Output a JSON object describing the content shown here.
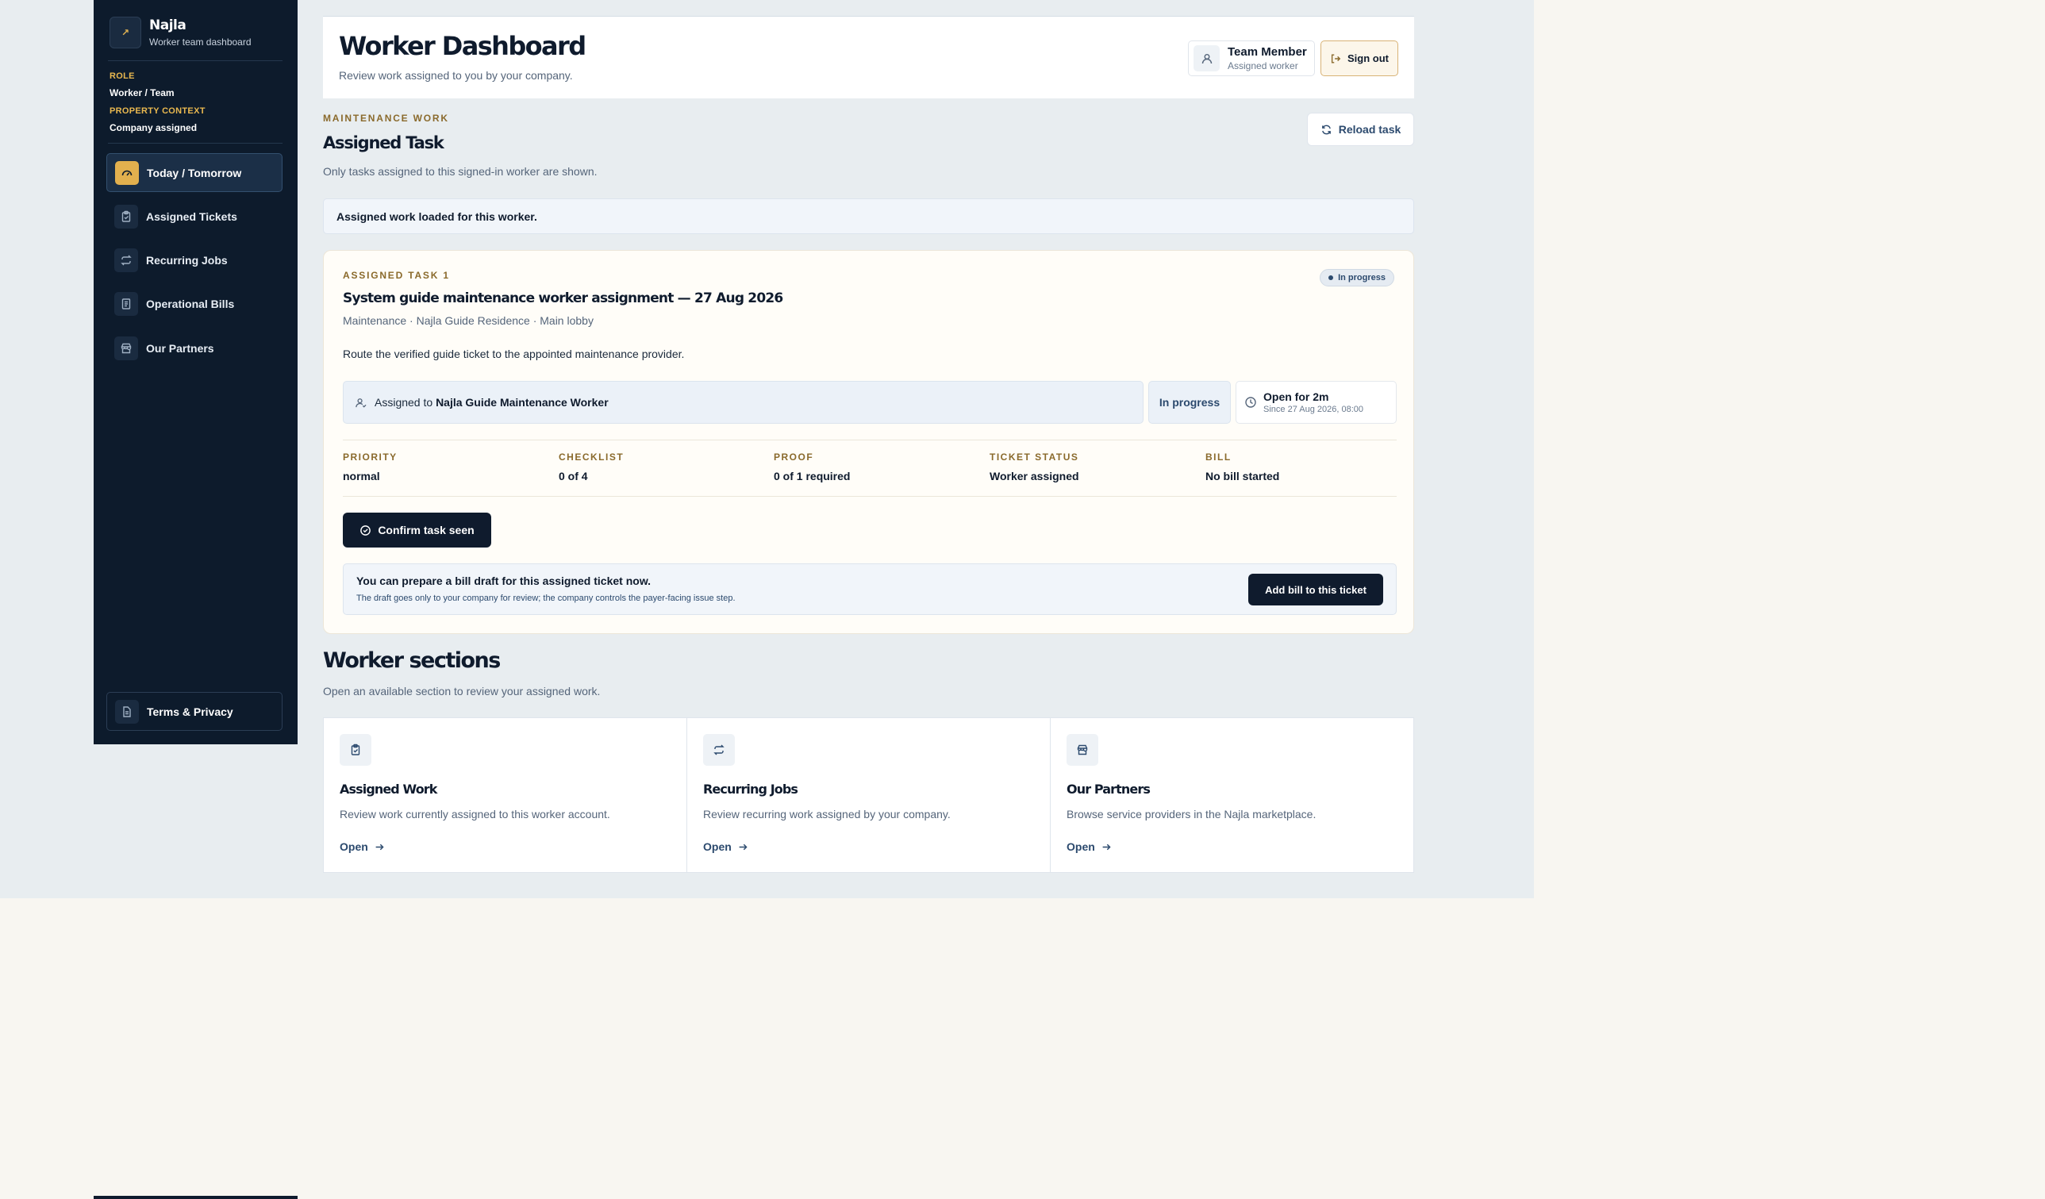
{
  "brand": {
    "logo_text": "↗",
    "name": "Najla",
    "subtitle": "Worker team dashboard"
  },
  "context": {
    "role_label": "ROLE",
    "role_value": "Worker / Team",
    "property_label": "PROPERTY CONTEXT",
    "property_value": "Company assigned"
  },
  "sidebar": {
    "items": [
      {
        "label": "Today / Tomorrow",
        "icon": "gauge-icon",
        "active": true
      },
      {
        "label": "Assigned Tickets",
        "icon": "clipboard-icon"
      },
      {
        "label": "Recurring Jobs",
        "icon": "repeat-icon"
      },
      {
        "label": "Operational Bills",
        "icon": "receipt-icon"
      },
      {
        "label": "Our Partners",
        "icon": "store-icon"
      }
    ],
    "terms_label": "Terms & Privacy"
  },
  "header": {
    "title": "Worker Dashboard",
    "subtitle": "Review work assigned to you by your company.",
    "user_name": "Team Member",
    "user_role": "Assigned worker",
    "signout_label": "Sign out"
  },
  "assigned": {
    "eyebrow": "MAINTENANCE WORK",
    "title": "Assigned Task",
    "subtitle": "Only tasks assigned to this signed-in worker are shown.",
    "reload_label": "Reload task",
    "notice": "Assigned work loaded for this worker."
  },
  "task": {
    "eyebrow": "ASSIGNED TASK 1",
    "badge": "In progress",
    "title": "System guide maintenance worker assignment — 27 Aug 2026",
    "meta": "Maintenance · Najla Guide Residence · Main lobby",
    "description": "Route the verified guide ticket to the appointed maintenance provider.",
    "assigned_prefix": "Assigned to",
    "assigned_name": "Najla Guide Maintenance Worker",
    "status": "In progress",
    "open_for": "Open for 2m",
    "open_since": "Since 27 Aug 2026, 08:00",
    "stats": [
      {
        "label": "PRIORITY",
        "value": "normal"
      },
      {
        "label": "CHECKLIST",
        "value": "0 of 4"
      },
      {
        "label": "PROOF",
        "value": "0 of 1 required"
      },
      {
        "label": "TICKET STATUS",
        "value": "Worker assigned"
      },
      {
        "label": "BILL",
        "value": "No bill started"
      }
    ],
    "confirm_label": "Confirm task seen",
    "bill_title": "You can prepare a bill draft for this assigned ticket now.",
    "bill_note": "The draft goes only to your company for review; the company controls the payer-facing issue step.",
    "bill_button": "Add bill to this ticket"
  },
  "worker_sections": {
    "title": "Worker sections",
    "subtitle": "Open an available section to review your assigned work.",
    "cards": [
      {
        "title": "Assigned Work",
        "desc": "Review work currently assigned to this worker account.",
        "link": "Open",
        "icon": "clipboard-icon"
      },
      {
        "title": "Recurring Jobs",
        "desc": "Review recurring work assigned by your company.",
        "link": "Open",
        "icon": "repeat-icon"
      },
      {
        "title": "Our Partners",
        "desc": "Browse service providers in the Najla marketplace.",
        "link": "Open",
        "icon": "store-icon"
      }
    ]
  },
  "colors": {
    "sidebar_bg": "#0d1b2c",
    "accent": "#e2b04e",
    "primary": "#0f1b2d",
    "link": "#2c4a6e"
  }
}
